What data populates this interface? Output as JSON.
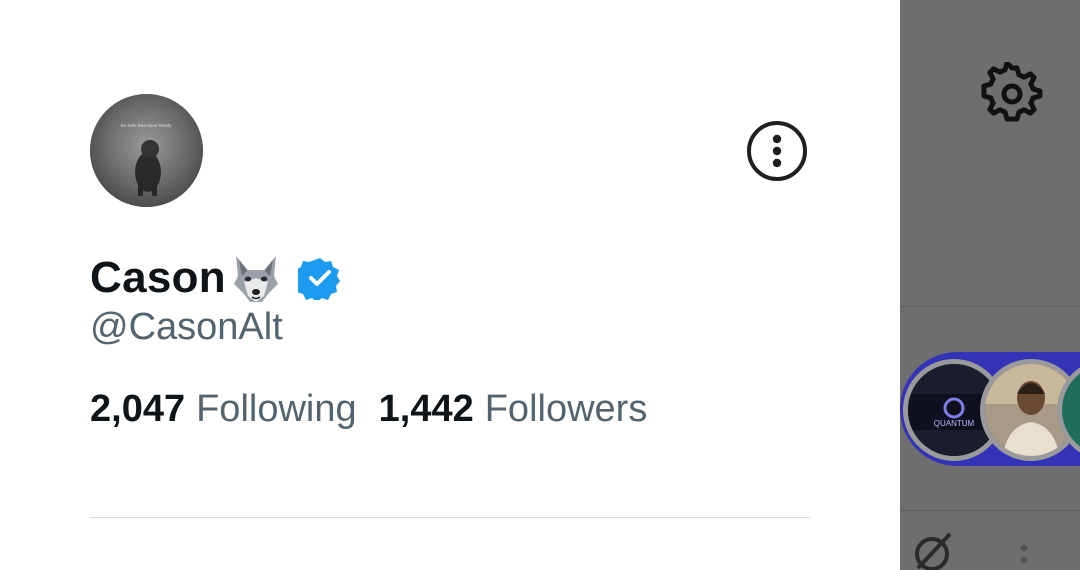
{
  "profile": {
    "display_name": "Cason",
    "name_emoji": "wolf-face",
    "verified": true,
    "handle": "@CasonAlt",
    "avatar_caption": "Be Safe Bast Beat Ready"
  },
  "stats": {
    "following_count": "2,047",
    "following_label": "Following",
    "followers_count": "1,442",
    "followers_label": "Followers"
  },
  "background": {
    "space_banner_text": "QUANTUM"
  },
  "icons": {
    "more": "more-options-icon",
    "verified": "verified-badge-icon",
    "settings": "gear-icon",
    "grok": "slash-circle-icon",
    "overflow": "vertical-dots-icon"
  },
  "colors": {
    "verified_blue": "#1d9bf0",
    "primary_text": "#0f1419",
    "secondary_text": "#536471",
    "backdrop": "#6e6e6e",
    "spaces_blue": "#3333b8"
  }
}
